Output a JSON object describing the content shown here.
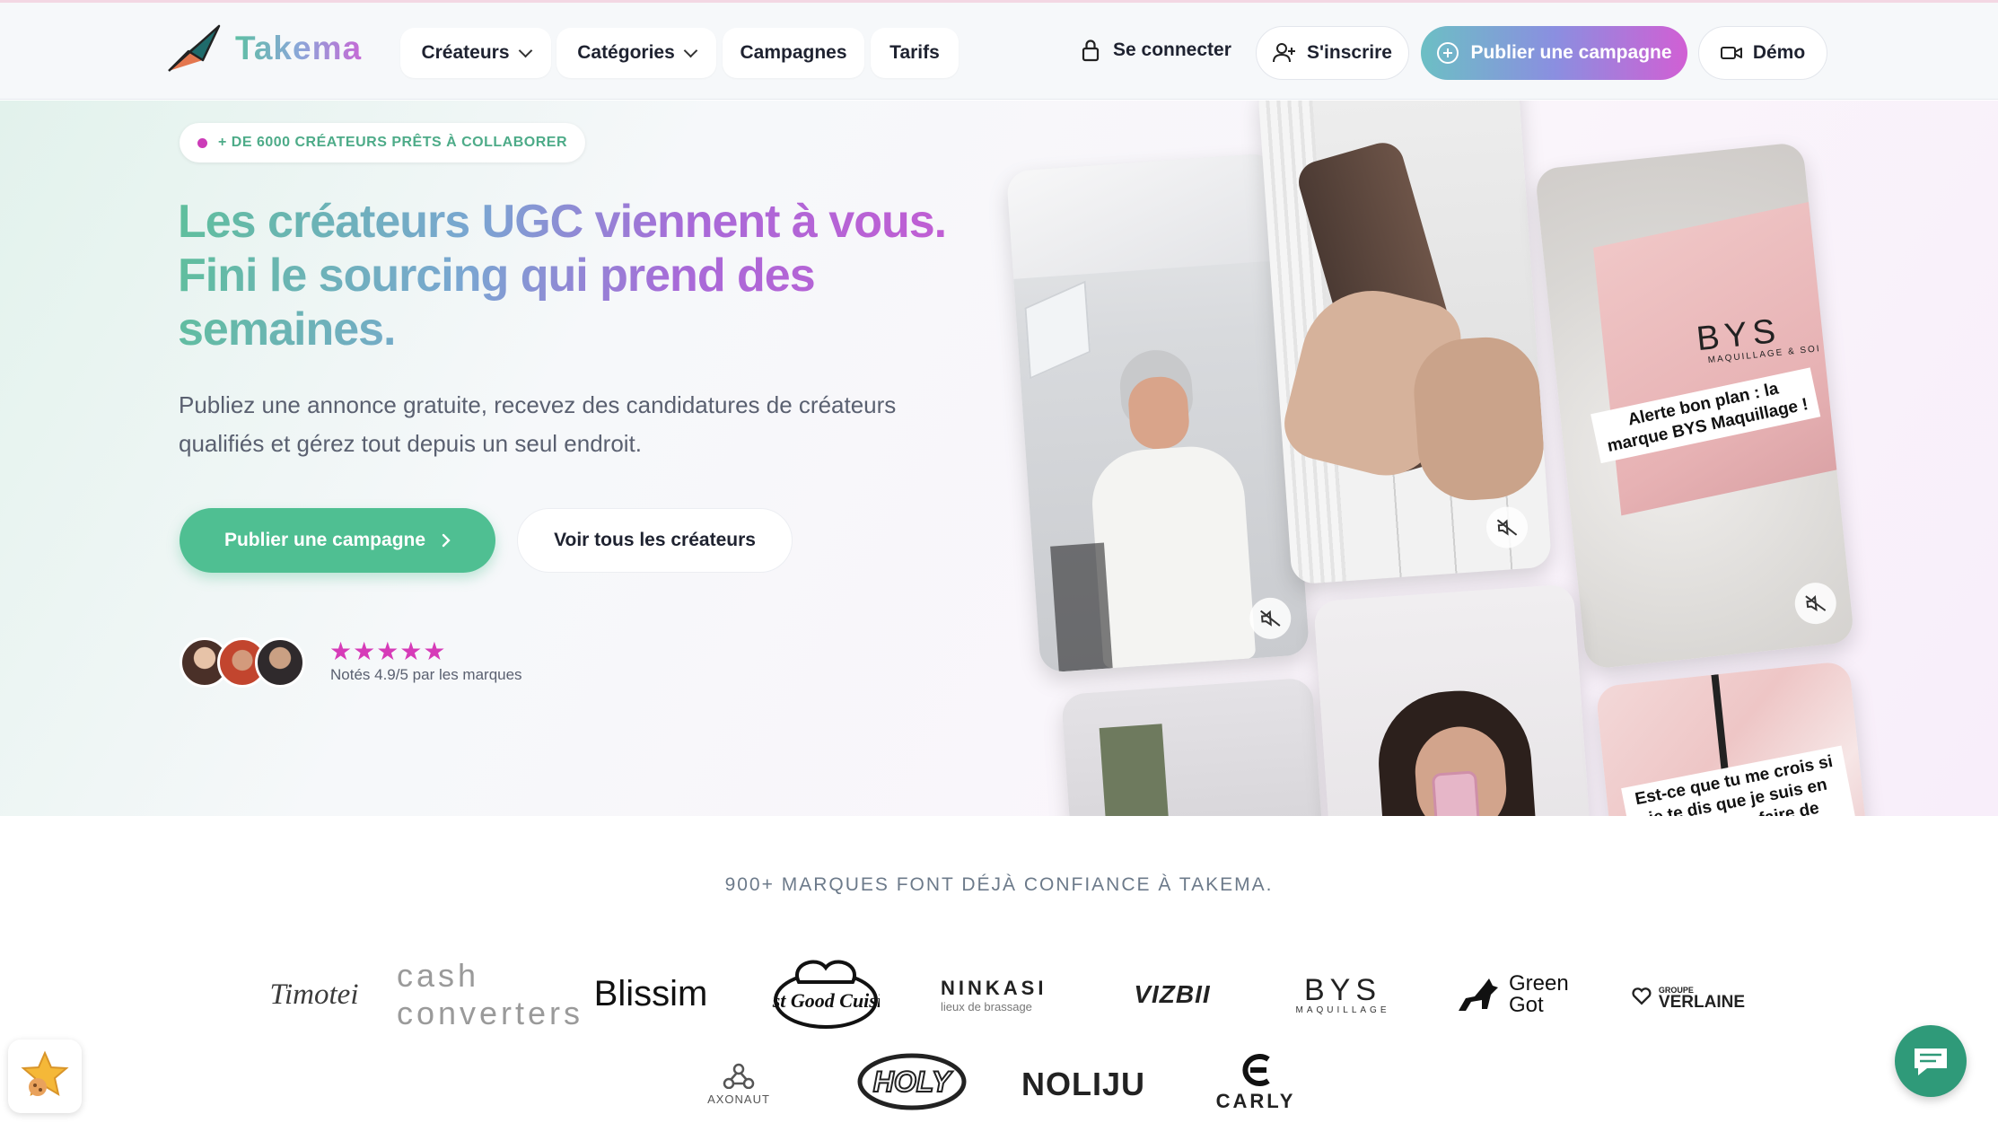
{
  "header": {
    "logo_text": "Takema",
    "nav": [
      {
        "label": "Créateurs",
        "has_dropdown": true
      },
      {
        "label": "Catégories",
        "has_dropdown": true
      },
      {
        "label": "Campagnes",
        "has_dropdown": false
      },
      {
        "label": "Tarifs",
        "has_dropdown": false
      }
    ],
    "login_label": "Se connecter",
    "signup_label": "S'inscrire",
    "publish_label": "Publier une campagne",
    "demo_label": "Démo"
  },
  "hero": {
    "badge": "+ DE 6000 CRÉATEURS PRÊTS À COLLABORER",
    "headline": "Les créateurs UGC viennent à vous. Fini le sourcing qui prend des semaines.",
    "subtitle": "Publiez une annonce gratuite, recevez des candidatures de créateurs qualifiés et gérez tout depuis un seul endroit.",
    "cta_primary": "Publier une campagne",
    "cta_secondary": "Voir tous les créateurs",
    "stars": "★★★★★",
    "rating_value": 5,
    "rating_text": "Notés 4.9/5 par les marques"
  },
  "videos": {
    "captions": [
      "Alerte bon plan : la marque BYS Maquillage !",
      "Est-ce que tu me crois si je te dis que je suis en train de me faire de"
    ],
    "bys_logo": "BYS",
    "bys_tagline": "MAQUILLAGE & SOI"
  },
  "brands": {
    "heading": "900+ MARQUES FONT DÉJÀ CONFIANCE À TAKEMA.",
    "logos": [
      "Timotei",
      "cash converters",
      "Blissim",
      "Fast Good Cuisine",
      "NINKASI",
      "lieux de brassage",
      "VIZBII",
      "BYS",
      "MAQUILLAGE",
      "Green Got",
      "GROUPE",
      "VERLAINE",
      "AXONAUT",
      "HOLY",
      "NOLIJU",
      "CARLY"
    ]
  },
  "colors": {
    "accent_green": "#4fbf92",
    "accent_pink": "#d63bb8",
    "accent_purple": "#a86ad8"
  },
  "icons": [
    "paper-plane-logo-icon",
    "lock-icon",
    "user-plus-icon",
    "plus-circle-icon",
    "video-camera-icon",
    "mute-icon",
    "chat-icon",
    "cookie-icon",
    "chevron-right-icon",
    "chevron-down-icon"
  ]
}
